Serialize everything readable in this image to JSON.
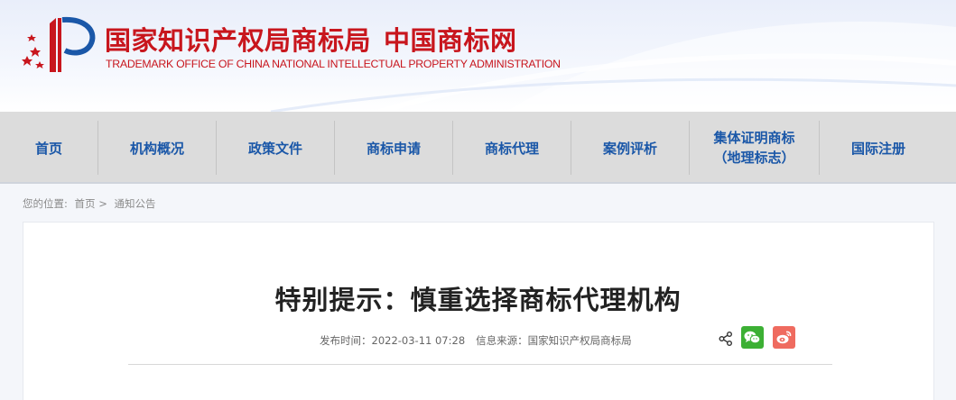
{
  "header": {
    "title_left": "国家知识产权局商标局",
    "title_right": "中国商标网",
    "subtitle": "TRADEMARK OFFICE OF CHINA NATIONAL INTELLECTUAL PROPERTY ADMINISTRATION",
    "brand_color": "#c8161d"
  },
  "nav": {
    "items": [
      {
        "label": "首页"
      },
      {
        "label": "机构概况"
      },
      {
        "label": "政策文件"
      },
      {
        "label": "商标申请"
      },
      {
        "label": "商标代理"
      },
      {
        "label": "案例评析"
      },
      {
        "label_line1": "集体证明商标",
        "label_line2": "（地理标志）"
      },
      {
        "label": "国际注册"
      }
    ],
    "text_color": "#1a57a8"
  },
  "breadcrumb": {
    "prefix": "您的位置:",
    "home": "首页",
    "sep": ">",
    "current": "通知公告"
  },
  "article": {
    "title": "特别提示：慎重选择商标代理机构",
    "publish_label": "发布时间：",
    "publish_time": "2022-03-11 07:28",
    "source_label": "信息来源：",
    "source": "国家知识产权局商标局"
  },
  "share": {
    "icons": [
      "share-icon",
      "wechat-icon",
      "weibo-icon"
    ],
    "wechat_color": "#3cb034",
    "weibo_color": "#ef6b5f"
  }
}
